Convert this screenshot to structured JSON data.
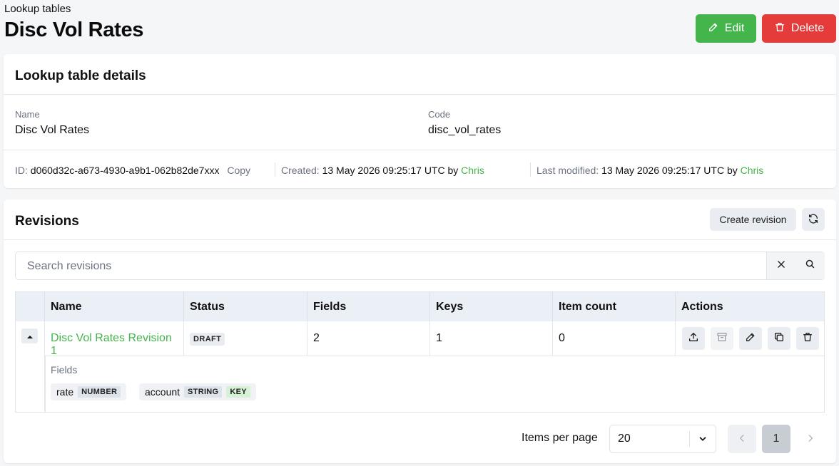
{
  "breadcrumb": "Lookup tables",
  "page_title": "Disc Vol Rates",
  "actions": {
    "edit": "Edit",
    "delete": "Delete"
  },
  "colors": {
    "accent_green": "#44b54b",
    "danger_red": "#e53b3b"
  },
  "details": {
    "title": "Lookup table details",
    "name_label": "Name",
    "name_value": "Disc Vol Rates",
    "code_label": "Code",
    "code_value": "disc_vol_rates",
    "id_label": "ID:",
    "id_value": "d060d32c-a673-4930-a9b1-062b82de7xxx",
    "copy": "Copy",
    "created_label": "Created:",
    "created_value": "13 May 2026 09:25:17 UTC by",
    "created_by": "Chris",
    "modified_label": "Last modified:",
    "modified_value": "13 May 2026 09:25:17 UTC by",
    "modified_by": "Chris"
  },
  "revisions": {
    "title": "Revisions",
    "create_button": "Create revision",
    "search_placeholder": "Search revisions",
    "columns": [
      "Name",
      "Status",
      "Fields",
      "Keys",
      "Item count",
      "Actions"
    ],
    "rows": [
      {
        "name": "Disc Vol Rates Revision 1",
        "status": "DRAFT",
        "fields": "2",
        "keys": "1",
        "item_count": "0"
      }
    ],
    "fields_label": "Fields",
    "fields": [
      {
        "name": "rate",
        "type": "NUMBER",
        "key": ""
      },
      {
        "name": "account",
        "type": "STRING",
        "key": "KEY"
      }
    ]
  },
  "pagination": {
    "items_per_page_label": "Items per page",
    "items_per_page_value": "20",
    "current_page": "1"
  },
  "icons": [
    "pencil-icon",
    "trash-icon",
    "refresh-icon",
    "close-icon",
    "search-icon",
    "caret-up-icon",
    "upload-icon",
    "archive-icon",
    "duplicate-icon",
    "chevron-down-icon",
    "chevron-left-icon",
    "chevron-right-icon"
  ]
}
